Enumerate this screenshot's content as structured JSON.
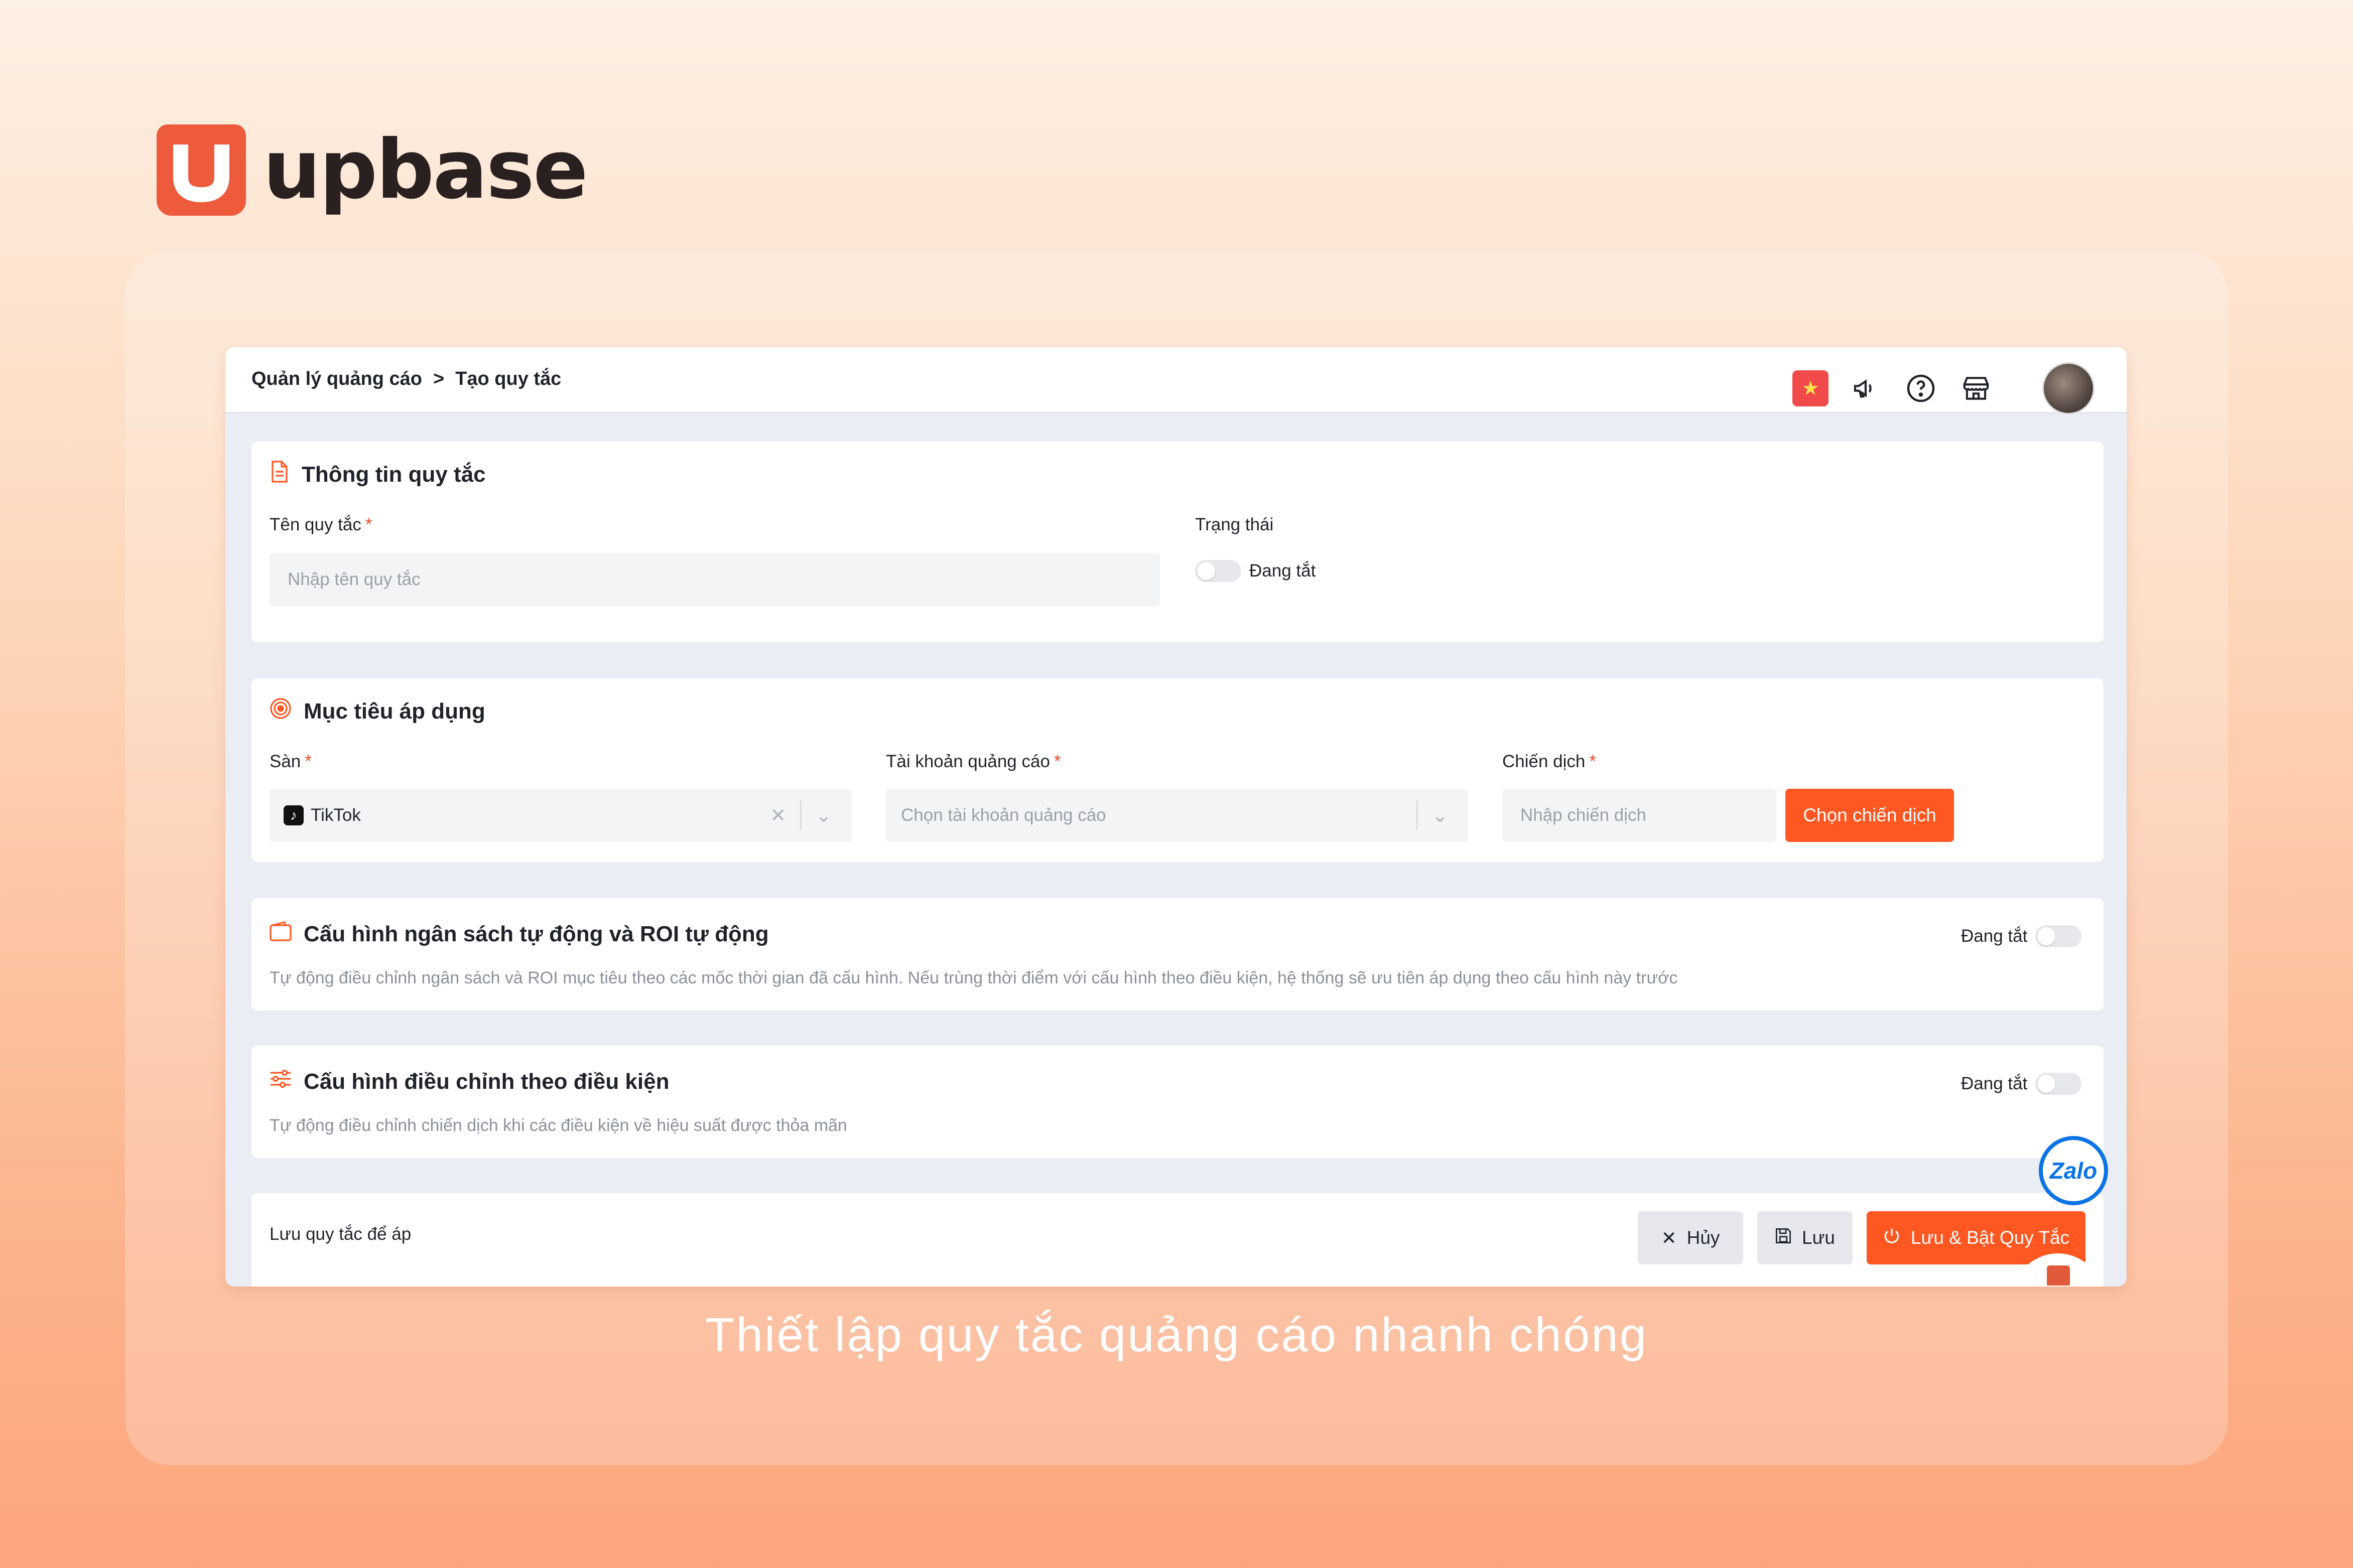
{
  "brand": {
    "name": "upbase"
  },
  "caption": "Thiết lập quy tắc quảng cáo nhanh chóng",
  "breadcrumb": {
    "parent": "Quản lý quảng cáo",
    "separator": ">",
    "current": "Tạo quy tắc"
  },
  "topbar_icons": [
    "vietnam-flag-icon",
    "megaphone-icon",
    "help-icon",
    "store-icon",
    "avatar"
  ],
  "rule_info": {
    "title": "Thông tin quy tắc",
    "name_label": "Tên quy tắc",
    "name_placeholder": "Nhập tên quy tắc",
    "status_label": "Trạng thái",
    "status_value": "Đang tắt",
    "required_mark": "*"
  },
  "target": {
    "title": "Mục tiêu áp dụng",
    "platform_label": "Sàn",
    "platform_value": "TikTok",
    "account_label": "Tài khoản quảng cáo",
    "account_placeholder": "Chọn tài khoản quảng cáo",
    "campaign_label": "Chiến dịch",
    "campaign_placeholder": "Nhập chiến dịch",
    "campaign_button": "Chọn chiến dịch",
    "required_mark": "*"
  },
  "auto_budget": {
    "title": "Cấu hình ngân sách tự động và ROI tự động",
    "toggle_label": "Đang tắt",
    "description": "Tự động điều chỉnh ngân sách và ROI mục tiêu theo các mốc thời gian đã cấu hình. Nếu trùng thời điểm với cấu hình theo điều kiện, hệ thống sẽ ưu tiên áp dụng theo cấu hình này trước"
  },
  "conditional": {
    "title": "Cấu hình điều chỉnh theo điều kiện",
    "toggle_label": "Đang tắt",
    "description": "Tự động điều chỉnh chiến dịch khi các điều kiện về hiệu suất được thỏa mãn"
  },
  "footer": {
    "hint": "Lưu quy tắc để áp",
    "cancel": "Hủy",
    "save": "Lưu",
    "save_enable": "Lưu & Bật Quy Tắc"
  },
  "zalo": "Zalo",
  "colors": {
    "primary": "#ff5722",
    "brand": "#ee5a3c",
    "zalo": "#0b74e5"
  }
}
